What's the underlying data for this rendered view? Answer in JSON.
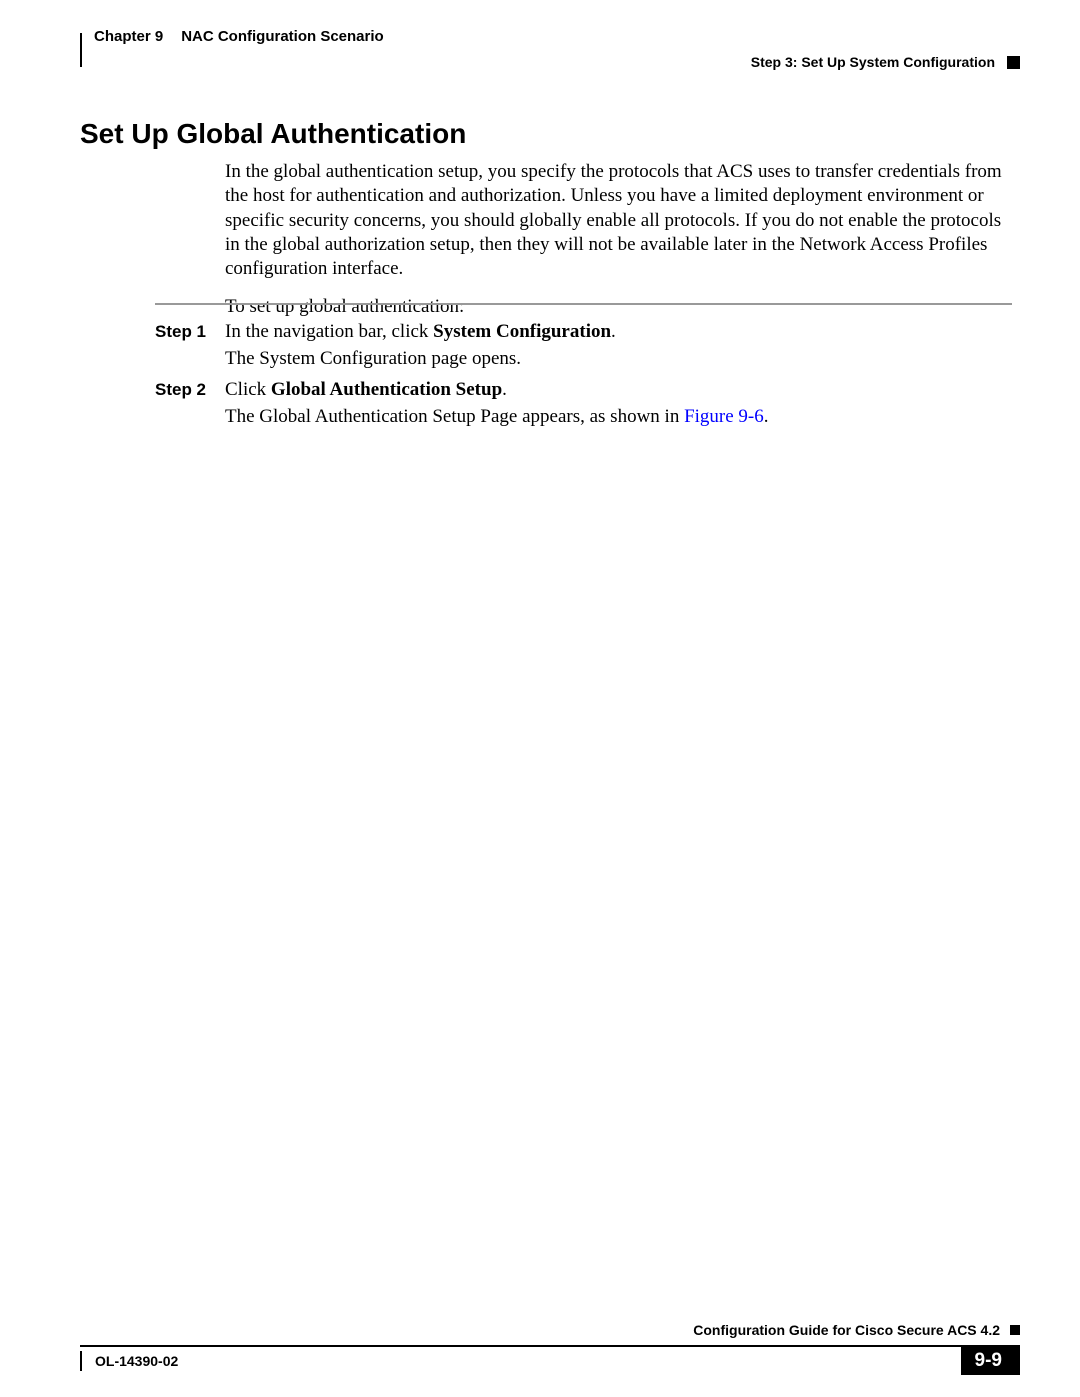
{
  "header": {
    "chapter_label": "Chapter 9",
    "chapter_title": "NAC Configuration Scenario",
    "step_label": "Step 3: Set Up System Configuration"
  },
  "section": {
    "title": "Set Up Global Authentication",
    "paragraph": "In the global authentication setup, you specify the protocols that ACS uses to transfer credentials from the host for authentication and authorization. Unless you have a limited deployment environment or specific security concerns, you should globally enable all protocols. If you do not enable the protocols in the global authorization setup, then they will not be available later in the Network Access Profiles configuration interface.",
    "intro": "To set up global authentication:"
  },
  "steps": [
    {
      "label": "Step 1",
      "line1_prefix": "In the navigation bar, click ",
      "line1_bold": "System Configuration",
      "line1_suffix": ".",
      "line2": "The System Configuration page opens."
    },
    {
      "label": "Step 2",
      "line1_prefix": "Click ",
      "line1_bold": "Global Authentication Setup",
      "line1_suffix": ".",
      "line2_prefix": "The Global Authentication Setup Page appears, as shown in ",
      "line2_link": "Figure 9-6",
      "line2_suffix": "."
    }
  ],
  "footer": {
    "guide": "Configuration Guide for Cisco Secure ACS 4.2",
    "ol": "OL-14390-02",
    "page": "9-9"
  }
}
